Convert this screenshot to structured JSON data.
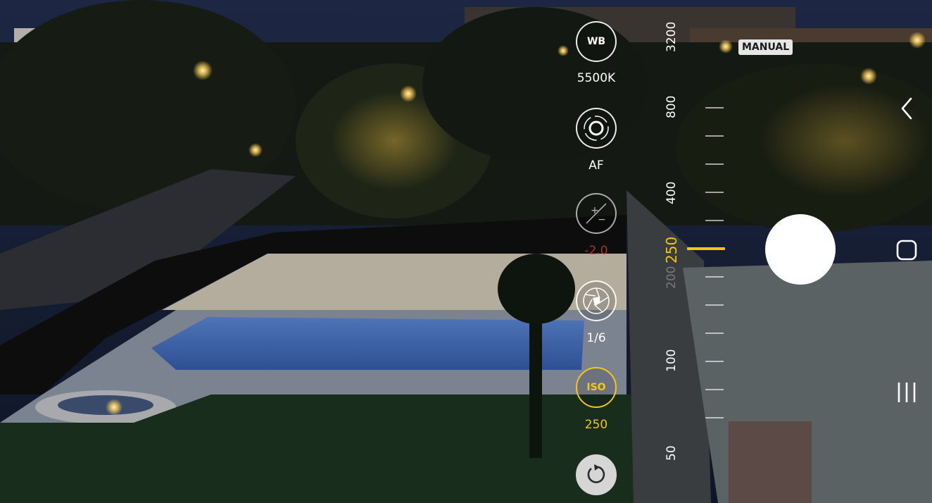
{
  "camera": {
    "mode_badge": "MANUAL",
    "wb": {
      "label": "WB",
      "value": "5500K",
      "icon": "wb-icon"
    },
    "focus": {
      "value": "AF",
      "icon": "focus-icon"
    },
    "exposure": {
      "value": "-2.0",
      "icon": "exposure-compensation-icon",
      "value_color": "#d9472b"
    },
    "shutter_speed": {
      "value": "1/6",
      "icon": "shutter-speed-icon"
    },
    "iso": {
      "label": "ISO",
      "value": "250",
      "accent": "#f5c518"
    },
    "reset": {
      "icon": "reset-icon"
    }
  },
  "iso_scale": {
    "labels": [
      "3200",
      "800",
      "400",
      "250",
      "200",
      "100",
      "50"
    ],
    "current": "250"
  },
  "nav": {
    "back_icon": "chevron-left-icon",
    "home_icon": "home-icon",
    "recents_icon": "recents-icon"
  }
}
